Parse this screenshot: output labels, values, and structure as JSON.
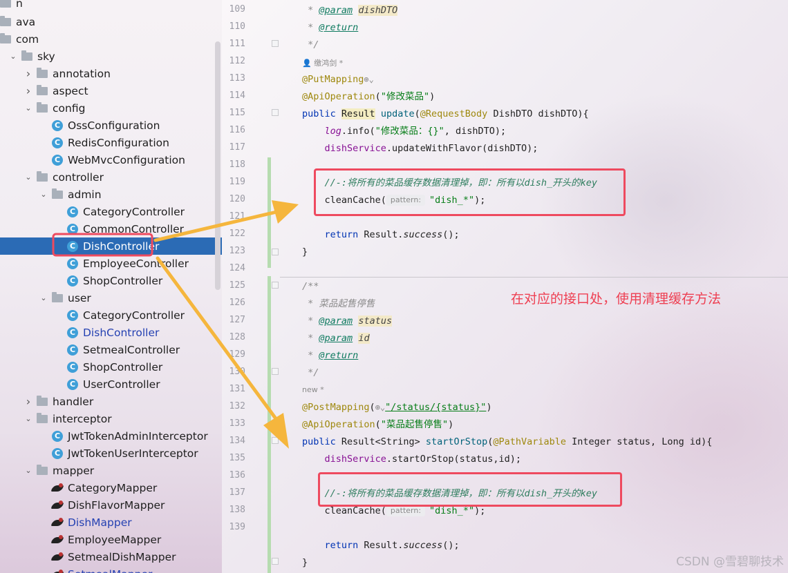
{
  "project_tree": {
    "rows": [
      {
        "depth": 0,
        "arrow": "",
        "icon": "folder",
        "label": "n"
      },
      {
        "depth": 0,
        "arrow": "",
        "icon": "folder",
        "label": "ava"
      },
      {
        "depth": 0,
        "arrow": "",
        "icon": "folder",
        "label": "com"
      },
      {
        "depth": 1,
        "arrow": "expanded",
        "icon": "folder",
        "label": "sky"
      },
      {
        "depth": 2,
        "arrow": "collapsed",
        "icon": "folder",
        "label": "annotation"
      },
      {
        "depth": 2,
        "arrow": "collapsed",
        "icon": "folder",
        "label": "aspect"
      },
      {
        "depth": 2,
        "arrow": "expanded",
        "icon": "folder",
        "label": "config"
      },
      {
        "depth": 3,
        "arrow": "",
        "icon": "class",
        "label": "OssConfiguration"
      },
      {
        "depth": 3,
        "arrow": "",
        "icon": "class",
        "label": "RedisConfiguration"
      },
      {
        "depth": 3,
        "arrow": "",
        "icon": "class",
        "label": "WebMvcConfiguration"
      },
      {
        "depth": 2,
        "arrow": "expanded",
        "icon": "folder",
        "label": "controller"
      },
      {
        "depth": 3,
        "arrow": "expanded",
        "icon": "folder",
        "label": "admin"
      },
      {
        "depth": 4,
        "arrow": "",
        "icon": "class",
        "label": "CategoryController"
      },
      {
        "depth": 4,
        "arrow": "",
        "icon": "class",
        "label": "CommonController"
      },
      {
        "depth": 4,
        "arrow": "",
        "icon": "class",
        "label": "DishController",
        "selected": true
      },
      {
        "depth": 4,
        "arrow": "",
        "icon": "class",
        "label": "EmployeeController"
      },
      {
        "depth": 4,
        "arrow": "",
        "icon": "class",
        "label": "ShopController"
      },
      {
        "depth": 3,
        "arrow": "expanded",
        "icon": "folder",
        "label": "user"
      },
      {
        "depth": 4,
        "arrow": "",
        "icon": "class",
        "label": "CategoryController"
      },
      {
        "depth": 4,
        "arrow": "",
        "icon": "class",
        "label": "DishController",
        "link": true
      },
      {
        "depth": 4,
        "arrow": "",
        "icon": "class",
        "label": "SetmealController"
      },
      {
        "depth": 4,
        "arrow": "",
        "icon": "class",
        "label": "ShopController"
      },
      {
        "depth": 4,
        "arrow": "",
        "icon": "class",
        "label": "UserController"
      },
      {
        "depth": 2,
        "arrow": "collapsed",
        "icon": "folder",
        "label": "handler"
      },
      {
        "depth": 2,
        "arrow": "expanded",
        "icon": "folder",
        "label": "interceptor"
      },
      {
        "depth": 3,
        "arrow": "",
        "icon": "class",
        "label": "JwtTokenAdminInterceptor"
      },
      {
        "depth": 3,
        "arrow": "",
        "icon": "class",
        "label": "JwtTokenUserInterceptor"
      },
      {
        "depth": 2,
        "arrow": "expanded",
        "icon": "folder",
        "label": "mapper"
      },
      {
        "depth": 3,
        "arrow": "",
        "icon": "mapper",
        "label": "CategoryMapper"
      },
      {
        "depth": 3,
        "arrow": "",
        "icon": "mapper",
        "label": "DishFlavorMapper"
      },
      {
        "depth": 3,
        "arrow": "",
        "icon": "mapper",
        "label": "DishMapper",
        "link": true
      },
      {
        "depth": 3,
        "arrow": "",
        "icon": "mapper",
        "label": "EmployeeMapper"
      },
      {
        "depth": 3,
        "arrow": "",
        "icon": "mapper",
        "label": "SetmealDishMapper"
      },
      {
        "depth": 3,
        "arrow": "",
        "icon": "mapper",
        "label": "SetmealMapper",
        "link": true
      }
    ]
  },
  "editor": {
    "author_hint_1": "缴鸿剑 *",
    "author_hint_2": "new *",
    "param_hint_label": "pattern:",
    "line_numbers": [
      "109",
      "110",
      "111",
      "112",
      "113",
      "114",
      "115",
      "116",
      "117",
      "118",
      "119",
      "120",
      "121",
      "122",
      "123",
      "124",
      "125",
      "126",
      "127",
      "128",
      "129",
      "130",
      "131",
      "132",
      "133",
      "134",
      "135",
      "136",
      "137",
      "138",
      "139"
    ],
    "annotation_text": "在对应的接口处，使用清理缓存方法",
    "watermark": "CSDN @雪碧聊技术",
    "tokens": {
      "l109_star": " * ",
      "l109_tag": "@param",
      "l109_name": "dishDTO",
      "l110_star": " * ",
      "l110_tag": "@return",
      "l111": " */",
      "l112_anno": "@PutMapping",
      "l112_icon": "⊕⌄",
      "l113_anno": "@ApiOperation",
      "l113_open": "(",
      "l113_str": "\"修改菜品\"",
      "l113_close": ")",
      "l114_kw": "public",
      "l114_type": "Result",
      "l114_method": "update",
      "l114_open": "(",
      "l114_anno": "@RequestBody",
      "l114_rest": " DishDTO dishDTO){",
      "l115_field": "log",
      "l115_mid": ".info(",
      "l115_str": "\"修改菜品：{}\"",
      "l115_rest": ", dishDTO);",
      "l116_field": "dishService",
      "l116_rest": ".updateWithFlavor(dishDTO);",
      "l118_comment": "//-:将所有的菜品缓存数据清理掉，即：所有以dish_开头的key",
      "l119_call": "cleanCache(",
      "l119_str": "\"dish_*\"",
      "l119_rest": ");",
      "l121_kw": "return",
      "l121_mid": " Result.",
      "l121_method": "success",
      "l121_rest": "();",
      "l122": "}",
      "l124": "/**",
      "l125": " * 菜品起售停售",
      "l126_star": " * ",
      "l126_tag": "@param",
      "l126_name": "status",
      "l127_star": " * ",
      "l127_tag": "@param",
      "l127_name": "id",
      "l128_star": " * ",
      "l128_tag": "@return",
      "l129": " */",
      "l130_anno": "@PostMapping",
      "l130_open": "(",
      "l130_icon": "⊕⌄",
      "l130_str": "\"/status/{status}\"",
      "l130_close": ")",
      "l131_anno": "@ApiOperation",
      "l131_open": "(",
      "l131_str": "\"菜品起售停售\"",
      "l131_close": ")",
      "l132_kw": "public",
      "l132_type": " Result<String> ",
      "l132_method": "startOrStop",
      "l132_open": "(",
      "l132_anno": "@PathVariable",
      "l132_rest": " Integer status, Long id){",
      "l133_field": "dishService",
      "l133_rest": ".startOrStop(status,id);",
      "l135_comment": "//-:将所有的菜品缓存数据清理掉，即：所有以dish_开头的key",
      "l136_call": "cleanCache(",
      "l136_str": "\"dish_*\"",
      "l136_rest": ");",
      "l138_kw": "return",
      "l138_mid": " Result.",
      "l138_method": "success",
      "l138_rest": "();",
      "l139": "}"
    }
  },
  "colors": {
    "selection": "#2b6bb5",
    "annotation_red": "#ee4a5f",
    "arrow_orange": "#f5b63d",
    "keyword": "#0033b3",
    "string": "#067d17"
  }
}
